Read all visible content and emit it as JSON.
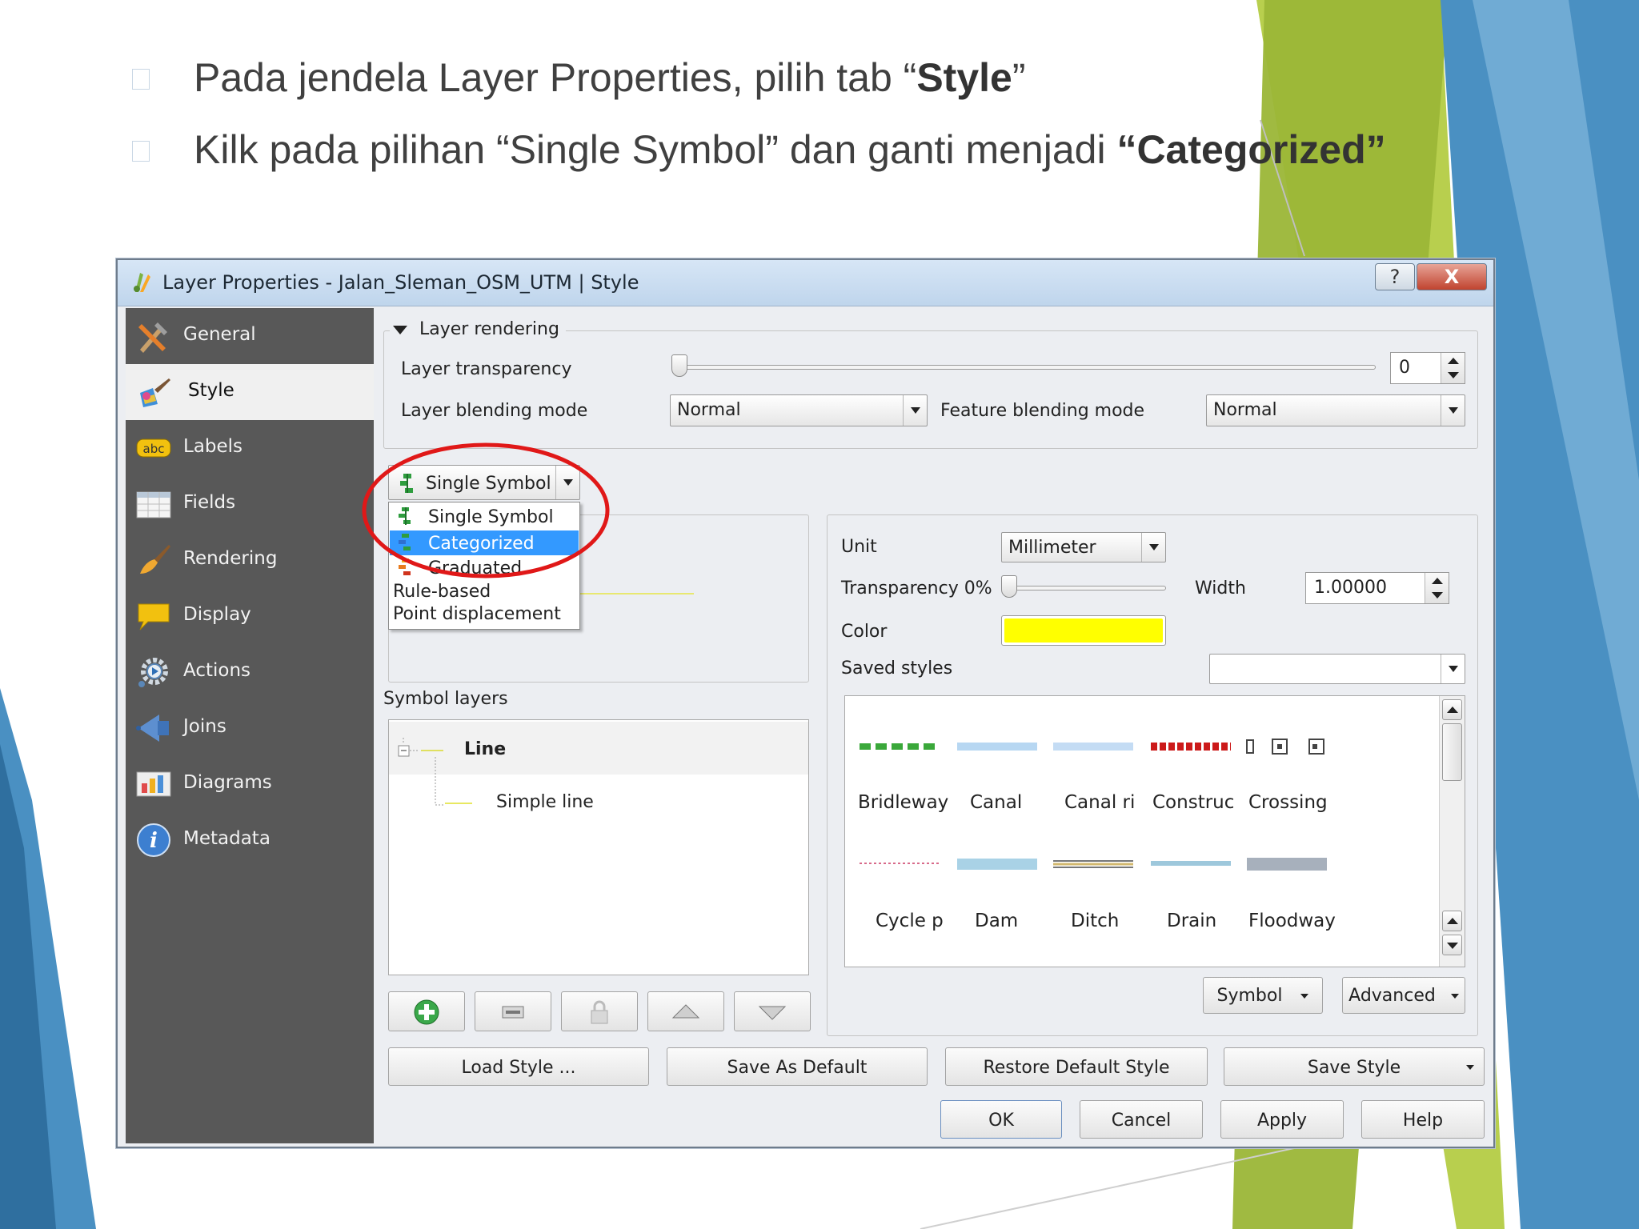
{
  "slide": {
    "bullet1": {
      "text": "Pada jendela Layer Properties, pilih tab “",
      "bold": "Style",
      "end": "”"
    },
    "bullet2": {
      "text": "Kilk pada pilihan “Single Symbol” dan ganti menjadi ",
      "bold": "“Categorized”"
    }
  },
  "dialog": {
    "title": "Layer Properties - Jalan_Sleman_OSM_UTM | Style",
    "help_glyph": "?",
    "close_glyph": "X"
  },
  "sidebar": {
    "items": [
      {
        "label": "General",
        "icon": "tools-icon"
      },
      {
        "label": "Style",
        "icon": "paintbrush-icon",
        "active": true
      },
      {
        "label": "Labels",
        "icon": "abc-label-icon"
      },
      {
        "label": "Fields",
        "icon": "table-icon"
      },
      {
        "label": "Rendering",
        "icon": "brush-icon"
      },
      {
        "label": "Display",
        "icon": "speech-bubble-icon"
      },
      {
        "label": "Actions",
        "icon": "gear-icon"
      },
      {
        "label": "Joins",
        "icon": "join-icon"
      },
      {
        "label": "Diagrams",
        "icon": "diagram-icon"
      },
      {
        "label": "Metadata",
        "icon": "info-icon"
      }
    ]
  },
  "rendering": {
    "group_title": "Layer rendering",
    "transparency_label": "Layer transparency",
    "transparency_value": "0",
    "transparency_level": 0,
    "blending_label": "Layer blending mode",
    "blending_value": "Normal",
    "feature_blending_label": "Feature blending mode",
    "feature_blending_value": "Normal"
  },
  "renderer": {
    "current": "Single Symbol",
    "options": [
      {
        "label": "Single Symbol",
        "icon": "single-symbol-icon"
      },
      {
        "label": "Categorized",
        "icon": "categorized-icon",
        "selected": true
      },
      {
        "label": "Graduated",
        "icon": "graduated-icon"
      },
      {
        "label": "Rule-based"
      },
      {
        "label": "Point displacement"
      }
    ]
  },
  "symbol_layers": {
    "label": "Symbol layers",
    "root": "Line",
    "child": "Simple line"
  },
  "symbol": {
    "unit_label": "Unit",
    "unit_value": "Millimeter",
    "transparency_label": "Transparency 0%",
    "transparency_level": 0,
    "width_label": "Width",
    "width_value": "1.00000",
    "color_label": "Color",
    "color_value": "#ffff00",
    "saved_styles_label": "Saved styles",
    "saved_styles_value": "",
    "styles": [
      {
        "name": "Bridleway",
        "shown": "Bridlewaу"
      },
      {
        "name": "Canal",
        "shown": "Canal"
      },
      {
        "name": "Canal ri",
        "shown": "Canal ri"
      },
      {
        "name": "Construc",
        "shown": "Construc"
      },
      {
        "name": "Crossing",
        "shown": "Crossing"
      },
      {
        "name": "Cycle p",
        "shown": "Cycle p"
      },
      {
        "name": "Dam",
        "shown": "Dam"
      },
      {
        "name": "Ditch",
        "shown": "Ditch"
      },
      {
        "name": "Drain",
        "shown": "Drain"
      },
      {
        "name": "Floodway",
        "shown": "Floodwaу"
      }
    ],
    "symbol_button": "Symbol",
    "advanced_button": "Advanced"
  },
  "footer": {
    "load_style": "Load Style ...",
    "save_default": "Save As Default",
    "restore_default": "Restore Default Style",
    "save_style": "Save Style",
    "ok": "OK",
    "cancel": "Cancel",
    "apply": "Apply",
    "help": "Help"
  },
  "colors": {
    "sidebar_bg": "#585858",
    "menu_highlight": "#3399ff",
    "annotation_circle": "#e01818",
    "deco_blue": "#4a90c2",
    "deco_green": "#9bb637"
  }
}
